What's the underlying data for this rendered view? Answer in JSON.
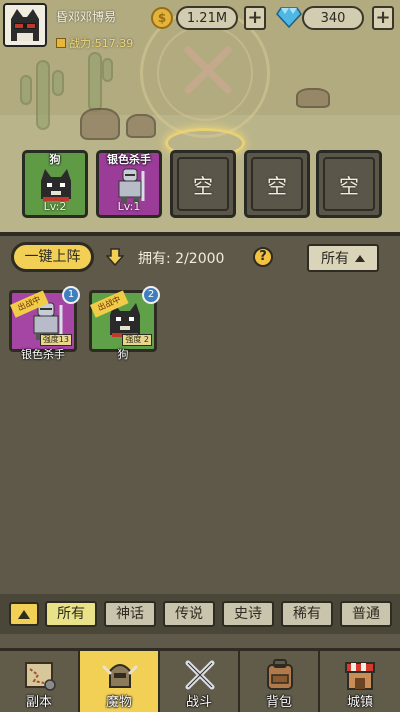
{
  "player": {
    "name": "昏邓邓博易",
    "power": "战力:517.39"
  },
  "resources": {
    "coins": "1.21M",
    "gems": "340"
  },
  "team_slots": [
    {
      "kind": "monster",
      "name": "狗",
      "level": "Lv:2",
      "rarity_color": "#5f9a45"
    },
    {
      "kind": "monster",
      "name": "银色杀手",
      "level": "Lv:1",
      "rarity_color": "#9a3c98"
    },
    {
      "kind": "empty",
      "label": "空"
    },
    {
      "kind": "empty",
      "label": "空"
    },
    {
      "kind": "empty",
      "label": "空"
    }
  ],
  "toolbar": {
    "deploy_all": "一键上阵",
    "owned": "拥有: 2/2000",
    "help": "?",
    "filter": "所有"
  },
  "inventory": [
    {
      "name": "银色杀手",
      "status": "出战中",
      "tag": "强度13",
      "count": "1",
      "rarity_color": "#a646a4"
    },
    {
      "name": "狗",
      "status": "出战中",
      "tag": "强度 2",
      "count": "2",
      "rarity_color": "#5fa048"
    }
  ],
  "categories": [
    "所有",
    "神话",
    "传说",
    "史诗",
    "稀有",
    "普通"
  ],
  "nav": [
    {
      "label": "副本",
      "icon": "map-icon"
    },
    {
      "label": "魔物",
      "icon": "helmet-icon"
    },
    {
      "label": "战斗",
      "icon": "crossed-swords-icon"
    },
    {
      "label": "背包",
      "icon": "backpack-icon"
    },
    {
      "label": "城镇",
      "icon": "shop-icon"
    }
  ]
}
